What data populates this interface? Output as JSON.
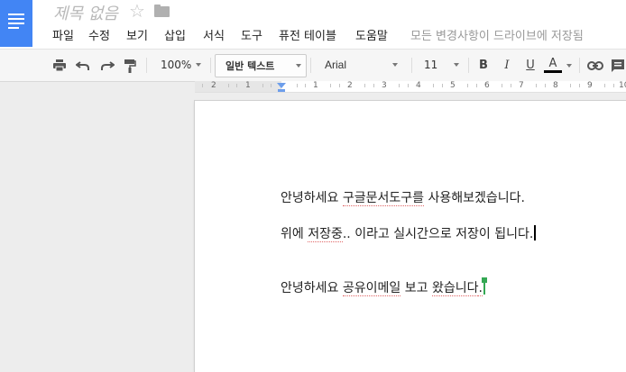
{
  "header": {
    "title": "제목 없음",
    "star_icon": "star-outline-icon",
    "folder_icon": "folder-icon"
  },
  "menu": {
    "items": [
      "파일",
      "수정",
      "보기",
      "삽입",
      "서식",
      "도구",
      "퓨전 테이블",
      "도움말"
    ],
    "save_status": "모든 변경사항이 드라이브에 저장됨"
  },
  "toolbar": {
    "zoom": "100%",
    "style": "일반 텍스트",
    "font": "Arial",
    "size": "11",
    "bold": "B",
    "italic": "I",
    "underline": "U",
    "text_color": "A",
    "text_color_bar": "#000000"
  },
  "ruler": {
    "numbers": [
      "2",
      "1",
      "1",
      "2",
      "3",
      "4",
      "5",
      "6",
      "7",
      "8",
      "9",
      "10"
    ]
  },
  "document": {
    "line1_a": "안녕하세요 ",
    "line1_b": "구글문서도구를",
    "line1_c": " 사용해보겠습니다.",
    "line2_a": "위에 ",
    "line2_b": "저장중",
    "line2_c": ".. 이라고 실시간으로 저장이 됩니다.",
    "line3_a": "안녕하세요 ",
    "line3_b": "공유이메일",
    "line3_c": " 보고 ",
    "line3_d": "왔습니다",
    "line3_e": "."
  },
  "colors": {
    "brand": "#4285f4",
    "collaborator_cursor": "#34a853"
  }
}
